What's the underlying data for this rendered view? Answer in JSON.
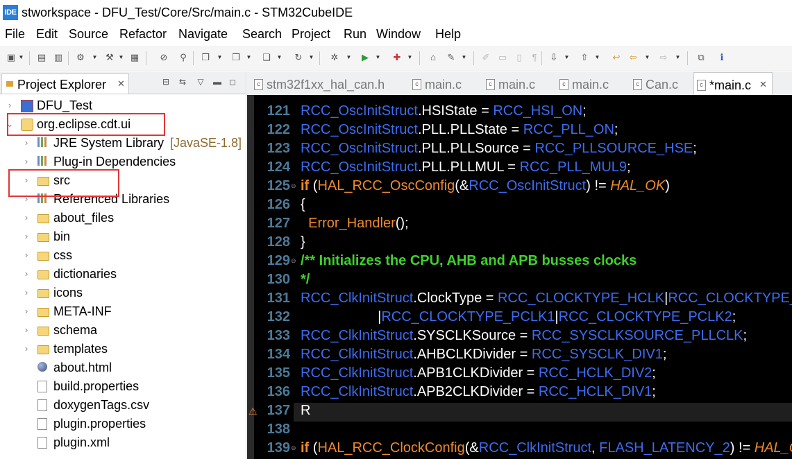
{
  "window": {
    "title": "stworkspace - DFU_Test/Core/Src/main.c - STM32CubeIDE",
    "logo_text": "IDE"
  },
  "menu": [
    "File",
    "Edit",
    "Source",
    "Refactor",
    "Navigate",
    "Search",
    "Project",
    "Run",
    "Window",
    "Help"
  ],
  "explorer": {
    "title": "Project Explorer",
    "close_glyph": "✕",
    "tree": [
      {
        "label": "DFU_Test",
        "decoration": "",
        "expanded": false,
        "indent": 0,
        "icon": "c-project-icon"
      },
      {
        "label": "org.eclipse.cdt.ui",
        "decoration": "",
        "expanded": true,
        "indent": 0,
        "icon": "plugin-project-icon"
      },
      {
        "label": "JRE System Library",
        "decoration": "[JavaSE-1.8]",
        "expanded": false,
        "indent": 1,
        "icon": "library-icon"
      },
      {
        "label": "Plug-in Dependencies",
        "decoration": "",
        "expanded": false,
        "indent": 1,
        "icon": "library-icon"
      },
      {
        "label": "src",
        "decoration": "",
        "expanded": false,
        "indent": 1,
        "icon": "source-folder-icon"
      },
      {
        "label": "Referenced Libraries",
        "decoration": "",
        "expanded": false,
        "indent": 1,
        "icon": "library-icon"
      },
      {
        "label": "about_files",
        "decoration": "",
        "expanded": false,
        "indent": 1,
        "icon": "folder-icon"
      },
      {
        "label": "bin",
        "decoration": "",
        "expanded": false,
        "indent": 1,
        "icon": "folder-icon"
      },
      {
        "label": "css",
        "decoration": "",
        "expanded": false,
        "indent": 1,
        "icon": "folder-icon"
      },
      {
        "label": "dictionaries",
        "decoration": "",
        "expanded": false,
        "indent": 1,
        "icon": "folder-icon"
      },
      {
        "label": "icons",
        "decoration": "",
        "expanded": false,
        "indent": 1,
        "icon": "folder-icon"
      },
      {
        "label": "META-INF",
        "decoration": "",
        "expanded": false,
        "indent": 1,
        "icon": "folder-icon"
      },
      {
        "label": "schema",
        "decoration": "",
        "expanded": false,
        "indent": 1,
        "icon": "folder-icon"
      },
      {
        "label": "templates",
        "decoration": "",
        "expanded": false,
        "indent": 1,
        "icon": "folder-icon"
      },
      {
        "label": "about.html",
        "decoration": "",
        "expanded": null,
        "indent": 1,
        "icon": "html-file-icon"
      },
      {
        "label": "build.properties",
        "decoration": "",
        "expanded": null,
        "indent": 1,
        "icon": "properties-file-icon"
      },
      {
        "label": "doxygenTags.csv",
        "decoration": "",
        "expanded": null,
        "indent": 1,
        "icon": "text-file-icon"
      },
      {
        "label": "plugin.properties",
        "decoration": "",
        "expanded": null,
        "indent": 1,
        "icon": "properties-file-icon"
      },
      {
        "label": "plugin.xml",
        "decoration": "",
        "expanded": null,
        "indent": 1,
        "icon": "xml-file-icon"
      }
    ]
  },
  "editor_tabs": [
    {
      "label": "stm32f1xx_hal_can.h",
      "active": false
    },
    {
      "label": "main.c",
      "active": false
    },
    {
      "label": "main.c",
      "active": false
    },
    {
      "label": "main.c",
      "active": false
    },
    {
      "label": "Can.c",
      "active": false
    },
    {
      "label": "*main.c",
      "active": true,
      "close": "✕"
    }
  ],
  "code": {
    "lines": [
      {
        "n": "121",
        "fold": "",
        "segs": [
          [
            "mac",
            "RCC_OscInitStruct"
          ],
          [
            "fld",
            ".HSIState = "
          ],
          [
            "mac",
            "RCC_HSI_ON"
          ],
          [
            "fld",
            ";"
          ]
        ]
      },
      {
        "n": "122",
        "fold": "",
        "segs": [
          [
            "mac",
            "RCC_OscInitStruct"
          ],
          [
            "fld",
            ".PLL.PLLState = "
          ],
          [
            "mac",
            "RCC_PLL_ON"
          ],
          [
            "fld",
            ";"
          ]
        ]
      },
      {
        "n": "123",
        "fold": "",
        "segs": [
          [
            "mac",
            "RCC_OscInitStruct"
          ],
          [
            "fld",
            ".PLL.PLLSource = "
          ],
          [
            "mac",
            "RCC_PLLSOURCE_HSE"
          ],
          [
            "fld",
            ";"
          ]
        ]
      },
      {
        "n": "124",
        "fold": "",
        "segs": [
          [
            "mac",
            "RCC_OscInitStruct"
          ],
          [
            "fld",
            ".PLL.PLLMUL = "
          ],
          [
            "mac",
            "RCC_PLL_MUL9"
          ],
          [
            "fld",
            ";"
          ]
        ]
      },
      {
        "n": "125",
        "fold": "⊖",
        "segs": [
          [
            "kw",
            "if"
          ],
          [
            "fld",
            " ("
          ],
          [
            "fn",
            "HAL_RCC_OscConfig"
          ],
          [
            "fld",
            "(&"
          ],
          [
            "mac",
            "RCC_OscInitStruct"
          ],
          [
            "fld",
            ") != "
          ],
          [
            "it",
            "HAL_OK"
          ],
          [
            "fld",
            ")"
          ]
        ]
      },
      {
        "n": "126",
        "fold": "",
        "segs": [
          [
            "fld",
            "{"
          ]
        ]
      },
      {
        "n": "127",
        "fold": "",
        "segs": [
          [
            "fld",
            "  "
          ],
          [
            "fn",
            "Error_Handler"
          ],
          [
            "fld",
            "();"
          ]
        ]
      },
      {
        "n": "128",
        "fold": "",
        "segs": [
          [
            "fld",
            "}"
          ]
        ]
      },
      {
        "n": "129",
        "fold": "⊖",
        "segs": [
          [
            "cmt",
            "/** Initializes the CPU, AHB and APB busses clocks"
          ]
        ]
      },
      {
        "n": "130",
        "fold": "",
        "segs": [
          [
            "cmt",
            "*/"
          ]
        ]
      },
      {
        "n": "131",
        "fold": "",
        "segs": [
          [
            "mac",
            "RCC_ClkInitStruct"
          ],
          [
            "fld",
            ".ClockType = "
          ],
          [
            "mac",
            "RCC_CLOCKTYPE_HCLK"
          ],
          [
            "fld",
            "|"
          ],
          [
            "mac",
            "RCC_CLOCKTYPE_SYSCLK"
          ]
        ]
      },
      {
        "n": "132",
        "fold": "",
        "segs": [
          [
            "fld",
            "                    |"
          ],
          [
            "mac",
            "RCC_CLOCKTYPE_PCLK1"
          ],
          [
            "fld",
            "|"
          ],
          [
            "mac",
            "RCC_CLOCKTYPE_PCLK2"
          ],
          [
            "fld",
            ";"
          ]
        ]
      },
      {
        "n": "133",
        "fold": "",
        "segs": [
          [
            "mac",
            "RCC_ClkInitStruct"
          ],
          [
            "fld",
            ".SYSCLKSource = "
          ],
          [
            "mac",
            "RCC_SYSCLKSOURCE_PLLCLK"
          ],
          [
            "fld",
            ";"
          ]
        ]
      },
      {
        "n": "134",
        "fold": "",
        "segs": [
          [
            "mac",
            "RCC_ClkInitStruct"
          ],
          [
            "fld",
            ".AHBCLKDivider = "
          ],
          [
            "mac",
            "RCC_SYSCLK_DIV1"
          ],
          [
            "fld",
            ";"
          ]
        ]
      },
      {
        "n": "135",
        "fold": "",
        "segs": [
          [
            "mac",
            "RCC_ClkInitStruct"
          ],
          [
            "fld",
            ".APB1CLKDivider = "
          ],
          [
            "mac",
            "RCC_HCLK_DIV2"
          ],
          [
            "fld",
            ";"
          ]
        ]
      },
      {
        "n": "136",
        "fold": "",
        "segs": [
          [
            "mac",
            "RCC_ClkInitStruct"
          ],
          [
            "fld",
            ".APB2CLKDivider = "
          ],
          [
            "mac",
            "RCC_HCLK_DIV1"
          ],
          [
            "fld",
            ";"
          ]
        ]
      },
      {
        "n": "137",
        "fold": "",
        "segs": [
          [
            "fld",
            "R"
          ]
        ]
      },
      {
        "n": "138",
        "fold": "",
        "segs": []
      },
      {
        "n": "139",
        "fold": "⊖",
        "segs": [
          [
            "kw",
            "if"
          ],
          [
            "fld",
            " ("
          ],
          [
            "fn",
            "HAL_RCC_ClockConfig"
          ],
          [
            "fld",
            "(&"
          ],
          [
            "mac",
            "RCC_ClkInitStruct"
          ],
          [
            "fld",
            ", "
          ],
          [
            "mac",
            "FLASH_LATENCY_2"
          ],
          [
            "fld",
            ") != "
          ],
          [
            "it",
            "HAL_OK"
          ],
          [
            "fld",
            ")"
          ]
        ]
      }
    ]
  },
  "colors": {
    "accent": "#2a7fd4",
    "highlight_box": "#e53333",
    "editor_bg": "#000000",
    "macro": "#3c6df0",
    "keyword": "#f08a2a",
    "comment": "#3fd12a",
    "line_number": "#4d7a99"
  }
}
